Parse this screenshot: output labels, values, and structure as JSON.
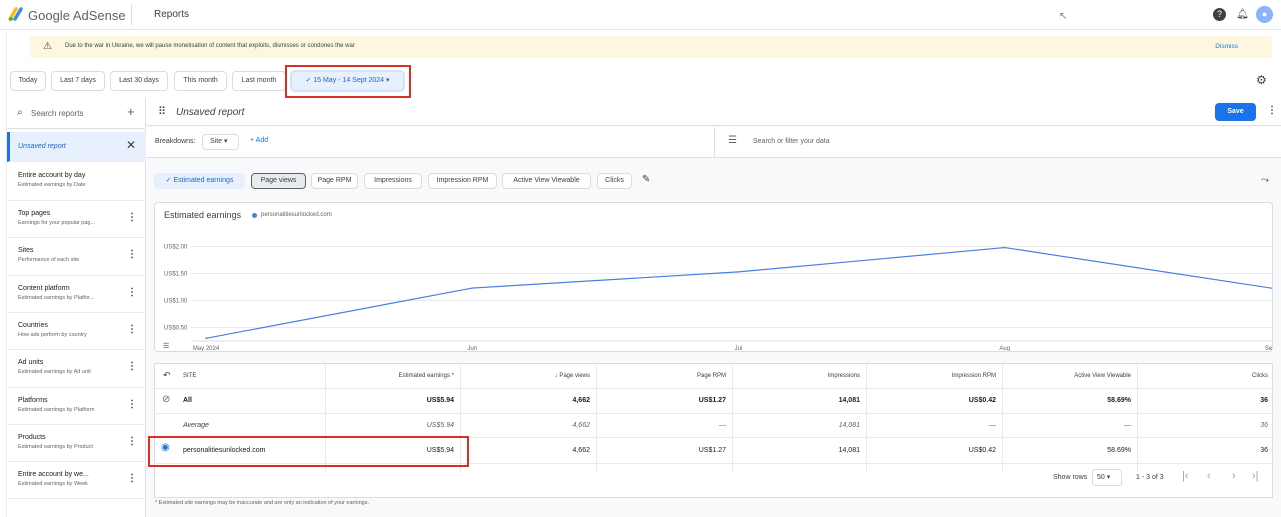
{
  "app": {
    "brand": "Google AdSense",
    "section": "Reports"
  },
  "banner": {
    "message": "Due to the war in Ukraine, we will pause monetisation of content that exploits, dismisses or condones the war",
    "dismiss": "Dismiss"
  },
  "date_ranges": [
    "Today",
    "Last 7 days",
    "Last 30 days",
    "This month",
    "Last month"
  ],
  "date_selected": "15 May - 14 Sept 2024",
  "sidebar": {
    "search_placeholder": "Search reports",
    "active": "Unsaved report",
    "items": [
      {
        "title": "Entire account by day",
        "sub": "Estimated earnings by Date"
      },
      {
        "title": "Top pages",
        "sub": "Earnings for your popular pag..."
      },
      {
        "title": "Sites",
        "sub": "Performance of each site"
      },
      {
        "title": "Content platform",
        "sub": "Estimated earnings by Platfor..."
      },
      {
        "title": "Countries",
        "sub": "How ads perform by country"
      },
      {
        "title": "Ad units",
        "sub": "Estimated earnings by Ad unit"
      },
      {
        "title": "Platforms",
        "sub": "Estimated earnings by Platform"
      },
      {
        "title": "Products",
        "sub": "Estimated earnings by Product"
      },
      {
        "title": "Entire account by we...",
        "sub": "Estimated earnings by Week"
      }
    ]
  },
  "report": {
    "title": "Unsaved report",
    "save": "Save",
    "breakdowns_label": "Breakdowns:",
    "breakdown_value": "Site",
    "add": "Add",
    "filter_placeholder": "Search or filter your data"
  },
  "metrics": [
    "Estimated earnings",
    "Page views",
    "Page RPM",
    "Impressions",
    "Impression RPM",
    "Active View Viewable",
    "Clicks"
  ],
  "chart_data": {
    "type": "line",
    "title": "Estimated earnings",
    "legend": "personalitiesunlocked.com",
    "x": [
      "May 2024",
      "Jun",
      "Jul",
      "Aug",
      "Sept"
    ],
    "y_ticks": [
      "US$2.00",
      "US$1.50",
      "US$1.00",
      "US$0.50"
    ],
    "ylim": [
      0.25,
      2.25
    ],
    "series": [
      {
        "name": "personalitiesunlocked.com",
        "values": [
          0.3,
          1.23,
          1.53,
          1.98,
          1.23
        ]
      }
    ],
    "color": "#4a7fde"
  },
  "table": {
    "headers": [
      "SITE",
      "Estimated earnings *",
      "Page views",
      "Page RPM",
      "Impressions",
      "Impression RPM",
      "Active View Viewable",
      "Clicks"
    ],
    "rows": [
      [
        "All",
        "US$5.94",
        "4,662",
        "US$1.27",
        "14,081",
        "US$0.42",
        "58.69%",
        "36"
      ],
      [
        "Average",
        "US$5.94",
        "4,662",
        "—",
        "14,081",
        "—",
        "—",
        "36"
      ],
      [
        "personalitiesunlocked.com",
        "US$5.94",
        "4,662",
        "US$1.27",
        "14,081",
        "US$0.42",
        "58.69%",
        "36"
      ]
    ],
    "show_rows_label": "Show rows",
    "rows_per_page": "50",
    "range": "1 - 3 of 3"
  },
  "footnote": "* Estimated site earnings may be inaccurate and are only an indication of your earnings."
}
